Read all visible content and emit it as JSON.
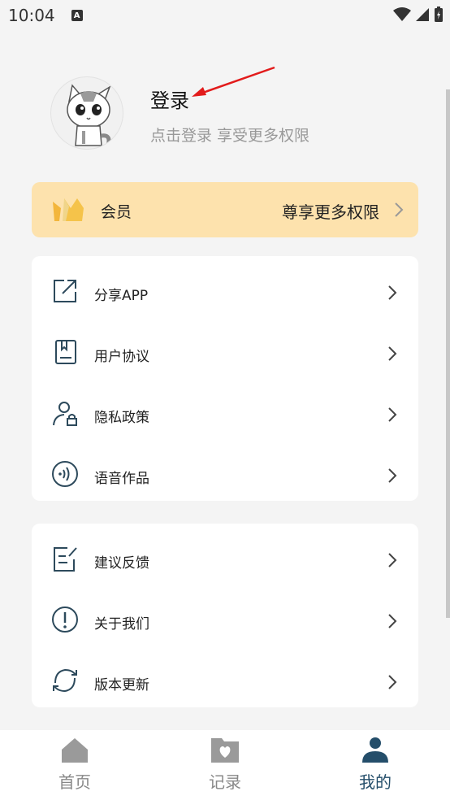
{
  "status": {
    "time": "10:04",
    "a_label": "A"
  },
  "profile": {
    "title": "登录",
    "subtitle": "点击登录 享受更多权限"
  },
  "vip": {
    "label": "会员",
    "right_text": "尊享更多权限"
  },
  "menu1": [
    {
      "label": "分享APP",
      "icon": "share-icon"
    },
    {
      "label": "用户协议",
      "icon": "agreement-icon"
    },
    {
      "label": "隐私政策",
      "icon": "privacy-icon"
    },
    {
      "label": "语音作品",
      "icon": "voice-icon"
    }
  ],
  "menu2": [
    {
      "label": "建议反馈",
      "icon": "feedback-icon"
    },
    {
      "label": "关于我们",
      "icon": "info-icon"
    },
    {
      "label": "版本更新",
      "icon": "update-icon"
    }
  ],
  "tabs": [
    {
      "label": "首页",
      "icon": "home-icon",
      "active": false
    },
    {
      "label": "记录",
      "icon": "record-icon",
      "active": false
    },
    {
      "label": "我的",
      "icon": "profile-icon",
      "active": true
    }
  ],
  "colors": {
    "accent": "#244e6a",
    "vip_bg": "#fde2ad",
    "icon": "#2d4a5c"
  }
}
